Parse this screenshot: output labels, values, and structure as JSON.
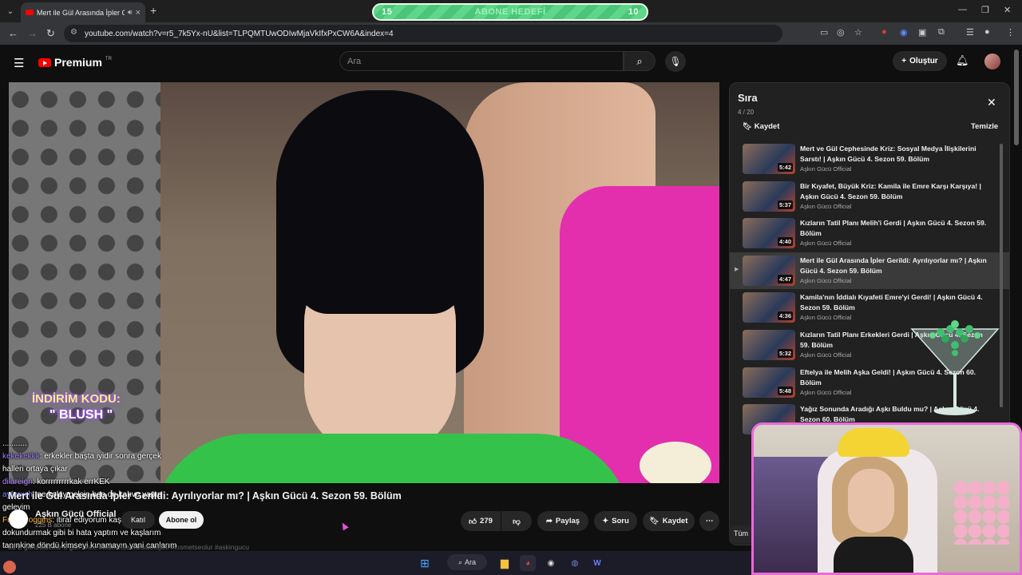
{
  "browser": {
    "tab_title": "Mert ile Gül Arasında İpler G",
    "url": "youtube.com/watch?v=r5_7k5Yx-nU&list=TLPQMTUwODIwMjaVkIfxPxCW6A&index=4"
  },
  "goal_bar": {
    "left": "15",
    "label": "ABONE HEDEFİ",
    "right": "10"
  },
  "header": {
    "logo_text": "Premium",
    "logo_sup": "TR",
    "search_placeholder": "Ara",
    "create_label": "Oluştur"
  },
  "overlay": {
    "promo_line1": "İNDİRİM KODU:",
    "promo_line2": "\" BLUSH \"",
    "chat_dots": "...........",
    "chat": [
      {
        "user": "kekekekkk",
        "msg": ": erkekler başta iyidir sonra gerçek"
      },
      {
        "user": "",
        "msg": "halleri ortaya çıkar"
      },
      {
        "user": "dilareign",
        "msg": ": korrrrrrrrrkak errKEK"
      },
      {
        "user": "ayferxch",
        "msg": ": ne kolay gelsin ben de kahve yapıp"
      },
      {
        "user": "",
        "msg": "geleyim"
      },
      {
        "user": "FrodoPoggins",
        "msg": ": itiraf ediyorum kaşlarına"
      },
      {
        "user": "",
        "msg": "dokundurmak gibi bi hata yaptım ve kaşlarım"
      },
      {
        "user": "",
        "msg": "tanınkine döndü kimseyi kınamayın yani canlarım"
      }
    ]
  },
  "video": {
    "title": "Mert ile Gül Arasında İpler Gerildi: Ayrılıyorlar mı? | Aşkın Gücü 4. Sezon 59. Bölüm",
    "channel": "Aşkın Gücü Official",
    "subs": "225 B abone",
    "join_label": "Katıl",
    "subscribe_label": "Abone ol",
    "likes": "279",
    "share_label": "Paylaş",
    "ask_label": "Soru",
    "save_label": "Kaydet",
    "desc_peek": "63 B görüntüleme  8 gün önce  #kısmetseolursaknojicii #kısmetseolur #askingucu"
  },
  "queue": {
    "title": "Sıra",
    "count": "4 / 20",
    "save_label": "Kaydet",
    "clear_label": "Temizle",
    "items": [
      {
        "title": "Mert ve Gül Cephesinde Kriz: Sosyal Medya İlişkilerini Sarstı! | Aşkın Gücü 4. Sezon 59. Bölüm",
        "channel": "Aşkın Gücü Official",
        "duration": "5:42",
        "marker": ""
      },
      {
        "title": "Bir Kıyafet, Büyük Kriz: Kamila ile Emre Karşı Karşıya! | Aşkın Gücü 4. Sezon 59. Bölüm",
        "channel": "Aşkın Gücü Official",
        "duration": "5:37",
        "marker": ""
      },
      {
        "title": "Kızların Tatil Planı Melih'i Gerdi | Aşkın Gücü 4. Sezon 59. Bölüm",
        "channel": "Aşkın Gücü Official",
        "duration": "4:40",
        "marker": ""
      },
      {
        "title": "Mert ile Gül Arasında İpler Gerildi: Ayrılıyorlar mı? | Aşkın Gücü 4. Sezon 59. Bölüm",
        "channel": "Aşkın Gücü Official",
        "duration": "4:47",
        "marker": "▶"
      },
      {
        "title": "Kamila'nın İddialı Kıyafeti Emre'yi Gerdi! | Aşkın Gücü 4. Sezon 59. Bölüm",
        "channel": "Aşkın Gücü Official",
        "duration": "4:36",
        "marker": ""
      },
      {
        "title": "Kızların Tatil Planı Erkekleri Gerdi | Aşkın Gücü 4. Sezon 59. Bölüm",
        "channel": "Aşkın Gücü Official",
        "duration": "5:32",
        "marker": ""
      },
      {
        "title": "Eftelya ile Melih Aşka Geldi! | Aşkın Gücü 4. Sezon 60. Bölüm",
        "channel": "Aşkın Gücü Official",
        "duration": "5:48",
        "marker": ""
      },
      {
        "title": "Yağız Sonunda Aradığı Aşkı Buldu mu? | Aşkın Gücü 4. Sezon 60. Bölüm",
        "channel": "Aşkın Gücü Official",
        "duration": "",
        "marker": ""
      }
    ],
    "chip_label": "Tüm"
  },
  "taskbar": {
    "search_label": "Ara"
  }
}
